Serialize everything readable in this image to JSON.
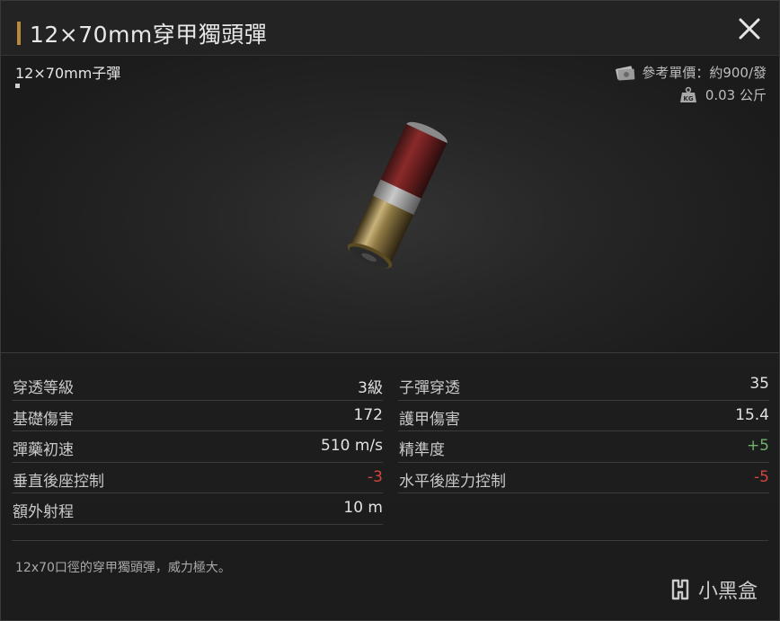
{
  "header": {
    "title": "12×70mm穿甲獨頭彈",
    "close_icon": "close-icon"
  },
  "item": {
    "subtitle": "12×70mm子彈",
    "price": "參考單價：約900/發",
    "weight": "0.03 公斤",
    "price_icon": "banknote-icon",
    "weight_icon": "weight-kg-icon"
  },
  "stats": {
    "left": [
      {
        "label": "穿透等級",
        "value": "3級",
        "tone": "neutral"
      },
      {
        "label": "基礎傷害",
        "value": "172",
        "tone": "neutral"
      },
      {
        "label": "彈藥初速",
        "value": "510 m/s",
        "tone": "neutral"
      },
      {
        "label": "垂直後座控制",
        "value": "-3",
        "tone": "negative"
      },
      {
        "label": "額外射程",
        "value": "10 m",
        "tone": "neutral"
      }
    ],
    "right": [
      {
        "label": "子彈穿透",
        "value": "35",
        "tone": "neutral"
      },
      {
        "label": "護甲傷害",
        "value": "15.4",
        "tone": "neutral"
      },
      {
        "label": "精準度",
        "value": "+5",
        "tone": "positive"
      },
      {
        "label": "水平後座力控制",
        "value": "-5",
        "tone": "negative"
      }
    ]
  },
  "description": "12x70口徑的穿甲獨頭彈，威力極大。",
  "watermark": {
    "text": "小黑盒",
    "logo_icon": "heybox-logo-icon"
  },
  "colors": {
    "accent": "#b98a3e",
    "positive": "#6fb36a",
    "negative": "#d0463d"
  }
}
